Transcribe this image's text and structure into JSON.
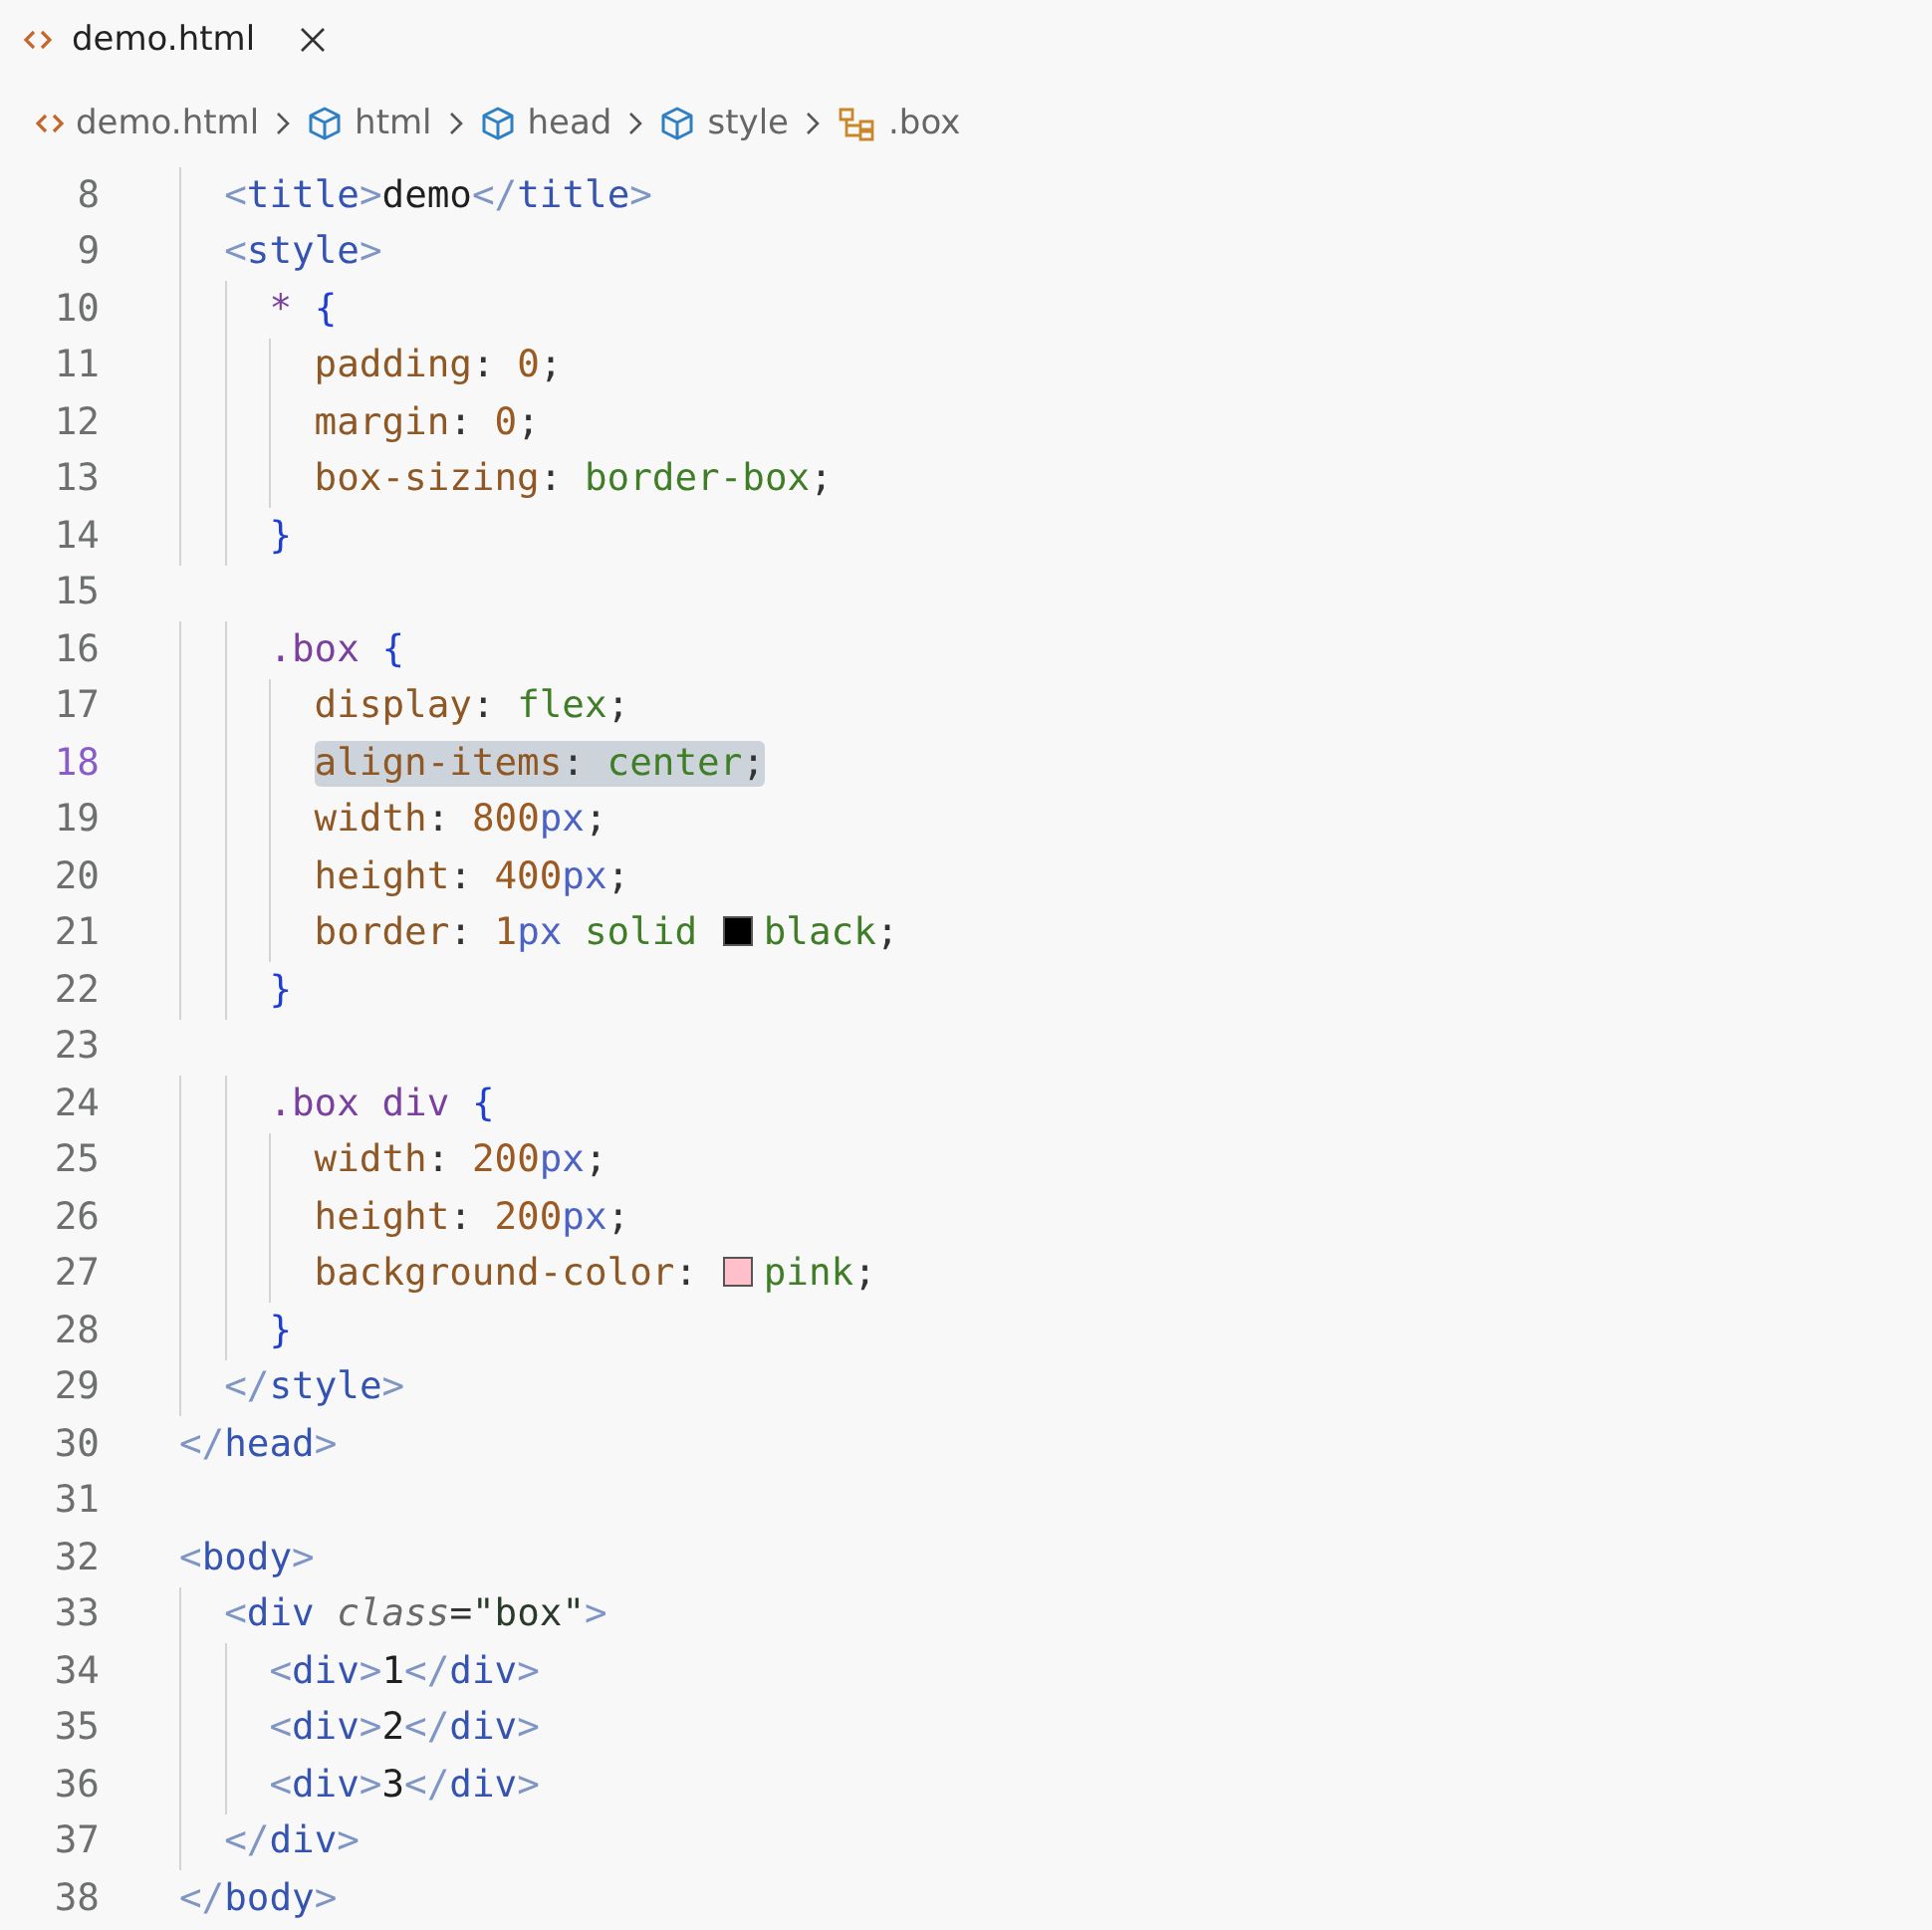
{
  "tab": {
    "label": "demo.html",
    "selected": true
  },
  "breadcrumbs": [
    {
      "kind": "file",
      "label": "demo.html"
    },
    {
      "kind": "element",
      "label": "html"
    },
    {
      "kind": "element",
      "label": "head"
    },
    {
      "kind": "element",
      "label": "style"
    },
    {
      "kind": "selector",
      "label": ".box"
    }
  ],
  "lines": [
    {
      "number": "8",
      "current": false,
      "highlighted": false,
      "code": [
        {
          "kind": "bracket",
          "text": "  <"
        },
        {
          "kind": "tag",
          "text": "title"
        },
        {
          "kind": "bracket",
          "text": ">"
        },
        {
          "kind": "text",
          "text": "demo"
        },
        {
          "kind": "bracket",
          "text": "</"
        },
        {
          "kind": "tag",
          "text": "title"
        },
        {
          "kind": "bracket",
          "text": ">"
        }
      ]
    },
    {
      "number": "9",
      "current": false,
      "highlighted": false,
      "code": [
        {
          "kind": "bracket",
          "text": "  <"
        },
        {
          "kind": "tag",
          "text": "style"
        },
        {
          "kind": "bracket",
          "text": ">"
        }
      ]
    },
    {
      "number": "10",
      "current": false,
      "highlighted": false,
      "code": [
        {
          "kind": "selector",
          "text": "    * "
        },
        {
          "kind": "brace",
          "text": "{"
        }
      ]
    },
    {
      "number": "11",
      "current": false,
      "highlighted": false,
      "code": [
        {
          "kind": "property",
          "text": "      padding"
        },
        {
          "kind": "punct",
          "text": ": "
        },
        {
          "kind": "number",
          "text": "0"
        },
        {
          "kind": "punct",
          "text": ";"
        }
      ]
    },
    {
      "number": "12",
      "current": false,
      "highlighted": false,
      "code": [
        {
          "kind": "property",
          "text": "      margin"
        },
        {
          "kind": "punct",
          "text": ": "
        },
        {
          "kind": "number",
          "text": "0"
        },
        {
          "kind": "punct",
          "text": ";"
        }
      ]
    },
    {
      "number": "13",
      "current": false,
      "highlighted": false,
      "code": [
        {
          "kind": "property",
          "text": "      box-sizing"
        },
        {
          "kind": "punct",
          "text": ": "
        },
        {
          "kind": "value",
          "text": "border-box"
        },
        {
          "kind": "punct",
          "text": ";"
        }
      ]
    },
    {
      "number": "14",
      "current": false,
      "highlighted": false,
      "code": [
        {
          "kind": "brace",
          "text": "    }"
        }
      ]
    },
    {
      "number": "15",
      "current": false
    },
    {
      "number": "16",
      "current": false,
      "highlighted": false,
      "code": [
        {
          "kind": "selector",
          "text": "    .box "
        },
        {
          "kind": "brace",
          "text": "{"
        }
      ]
    },
    {
      "number": "17",
      "current": false,
      "highlighted": false,
      "code": [
        {
          "kind": "property",
          "text": "      display"
        },
        {
          "kind": "punct",
          "text": ": "
        },
        {
          "kind": "value",
          "text": "flex"
        },
        {
          "kind": "punct",
          "text": ";"
        }
      ]
    },
    {
      "number": "18",
      "current": true,
      "highlighted": true,
      "code": [
        {
          "kind": "property",
          "text": "      align-items"
        },
        {
          "kind": "punct",
          "text": ": "
        },
        {
          "kind": "value",
          "text": "center"
        },
        {
          "kind": "punct",
          "text": ";"
        }
      ]
    },
    {
      "number": "19",
      "current": false,
      "highlighted": false,
      "code": [
        {
          "kind": "property",
          "text": "      width"
        },
        {
          "kind": "punct",
          "text": ": "
        },
        {
          "kind": "number",
          "text": "800"
        },
        {
          "kind": "unit",
          "text": "px"
        },
        {
          "kind": "punct",
          "text": ";"
        }
      ]
    },
    {
      "number": "20",
      "current": false,
      "highlighted": false,
      "code": [
        {
          "kind": "property",
          "text": "      height"
        },
        {
          "kind": "punct",
          "text": ": "
        },
        {
          "kind": "number",
          "text": "400"
        },
        {
          "kind": "unit",
          "text": "px"
        },
        {
          "kind": "punct",
          "text": ";"
        }
      ]
    },
    {
      "number": "21",
      "current": false,
      "highlighted": false,
      "code": [
        {
          "kind": "property",
          "text": "      border"
        },
        {
          "kind": "punct",
          "text": ": "
        },
        {
          "kind": "number",
          "text": "1"
        },
        {
          "kind": "unit",
          "text": "px"
        },
        {
          "kind": "value",
          "text": " solid "
        },
        {
          "kind": "swatch",
          "color": "#000000"
        },
        {
          "kind": "value",
          "text": "black"
        },
        {
          "kind": "punct",
          "text": ";"
        }
      ]
    },
    {
      "number": "22",
      "current": false,
      "highlighted": false,
      "code": [
        {
          "kind": "brace",
          "text": "    }"
        }
      ]
    },
    {
      "number": "23",
      "current": false
    },
    {
      "number": "24",
      "current": false,
      "highlighted": false,
      "code": [
        {
          "kind": "selector",
          "text": "    .box div "
        },
        {
          "kind": "brace",
          "text": "{"
        }
      ]
    },
    {
      "number": "25",
      "current": false,
      "highlighted": false,
      "code": [
        {
          "kind": "property",
          "text": "      width"
        },
        {
          "kind": "punct",
          "text": ": "
        },
        {
          "kind": "number",
          "text": "200"
        },
        {
          "kind": "unit",
          "text": "px"
        },
        {
          "kind": "punct",
          "text": ";"
        }
      ]
    },
    {
      "number": "26",
      "current": false,
      "highlighted": false,
      "code": [
        {
          "kind": "property",
          "text": "      height"
        },
        {
          "kind": "punct",
          "text": ": "
        },
        {
          "kind": "number",
          "text": "200"
        },
        {
          "kind": "unit",
          "text": "px"
        },
        {
          "kind": "punct",
          "text": ";"
        }
      ]
    },
    {
      "number": "27",
      "current": false,
      "highlighted": false,
      "code": [
        {
          "kind": "property",
          "text": "      background-color"
        },
        {
          "kind": "punct",
          "text": ": "
        },
        {
          "kind": "swatch",
          "color": "#ffc0cb"
        },
        {
          "kind": "value",
          "text": "pink"
        },
        {
          "kind": "punct",
          "text": ";"
        }
      ]
    },
    {
      "number": "28",
      "current": false,
      "highlighted": false,
      "code": [
        {
          "kind": "brace",
          "text": "    }"
        }
      ]
    },
    {
      "number": "29",
      "current": false,
      "highlighted": false,
      "code": [
        {
          "kind": "bracket",
          "text": "  </"
        },
        {
          "kind": "tag",
          "text": "style"
        },
        {
          "kind": "bracket",
          "text": ">"
        }
      ]
    },
    {
      "number": "30",
      "current": false,
      "highlighted": false,
      "code": [
        {
          "kind": "bracket",
          "text": "</"
        },
        {
          "kind": "tag",
          "text": "head"
        },
        {
          "kind": "bracket",
          "text": ">"
        }
      ]
    },
    {
      "number": "31",
      "current": false
    },
    {
      "number": "32",
      "current": false,
      "highlighted": false,
      "code": [
        {
          "kind": "bracket",
          "text": "<"
        },
        {
          "kind": "tag",
          "text": "body"
        },
        {
          "kind": "bracket",
          "text": ">"
        }
      ]
    },
    {
      "number": "33",
      "current": false,
      "highlighted": false,
      "code": [
        {
          "kind": "bracket",
          "text": "  <"
        },
        {
          "kind": "tag",
          "text": "div "
        },
        {
          "kind": "attr",
          "text": "class"
        },
        {
          "kind": "punct",
          "text": "="
        },
        {
          "kind": "string",
          "text": "\"box\""
        },
        {
          "kind": "bracket",
          "text": ">"
        }
      ]
    },
    {
      "number": "34",
      "current": false,
      "highlighted": false,
      "code": [
        {
          "kind": "bracket",
          "text": "    <"
        },
        {
          "kind": "tag",
          "text": "div"
        },
        {
          "kind": "bracket",
          "text": ">"
        },
        {
          "kind": "text",
          "text": "1"
        },
        {
          "kind": "bracket",
          "text": "</"
        },
        {
          "kind": "tag",
          "text": "div"
        },
        {
          "kind": "bracket",
          "text": ">"
        }
      ]
    },
    {
      "number": "35",
      "current": false,
      "highlighted": false,
      "code": [
        {
          "kind": "bracket",
          "text": "    <"
        },
        {
          "kind": "tag",
          "text": "div"
        },
        {
          "kind": "bracket",
          "text": ">"
        },
        {
          "kind": "text",
          "text": "2"
        },
        {
          "kind": "bracket",
          "text": "</"
        },
        {
          "kind": "tag",
          "text": "div"
        },
        {
          "kind": "bracket",
          "text": ">"
        }
      ]
    },
    {
      "number": "36",
      "current": false,
      "highlighted": false,
      "code": [
        {
          "kind": "bracket",
          "text": "    <"
        },
        {
          "kind": "tag",
          "text": "div"
        },
        {
          "kind": "bracket",
          "text": ">"
        },
        {
          "kind": "text",
          "text": "3"
        },
        {
          "kind": "bracket",
          "text": "</"
        },
        {
          "kind": "tag",
          "text": "div"
        },
        {
          "kind": "bracket",
          "text": ">"
        }
      ]
    },
    {
      "number": "37",
      "current": false,
      "highlighted": false,
      "code": [
        {
          "kind": "bracket",
          "text": "  </"
        },
        {
          "kind": "tag",
          "text": "div"
        },
        {
          "kind": "bracket",
          "text": ">"
        }
      ]
    },
    {
      "number": "38",
      "current": false,
      "highlighted": false,
      "code": [
        {
          "kind": "bracket",
          "text": "</"
        },
        {
          "kind": "tag",
          "text": "body"
        },
        {
          "kind": "bracket",
          "text": ">"
        }
      ]
    }
  ]
}
